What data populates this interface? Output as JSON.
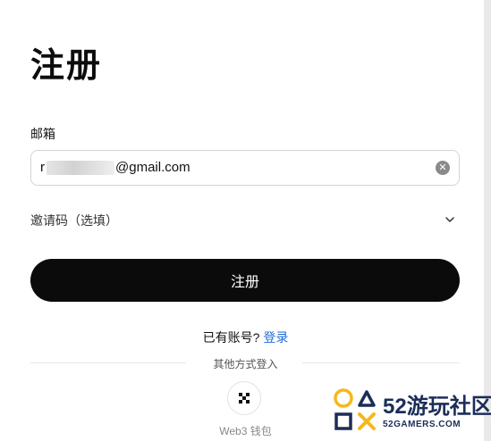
{
  "header": {
    "title": "注册"
  },
  "form": {
    "email_label": "邮箱",
    "email_value_prefix": "r",
    "email_value_suffix": "@gmail.com",
    "clear_icon": "close-circle-icon",
    "invite_label": "邀请码（选填）",
    "invite_icon": "chevron-down-icon",
    "submit_label": "注册"
  },
  "footer": {
    "have_account": "已有账号?",
    "login_link": "登录",
    "other_methods": "其他方式登入",
    "web3_label": "Web3 钱包",
    "web3_icon": "web3-wallet-icon"
  },
  "watermark": {
    "brand": "52游玩社区",
    "sub": "52GAMERS.COM",
    "accent_yellow": "#f5b81c",
    "accent_navy": "#1c2d59"
  },
  "colors": {
    "primary_button": "#0b0b0b",
    "link": "#1e6bd6"
  }
}
